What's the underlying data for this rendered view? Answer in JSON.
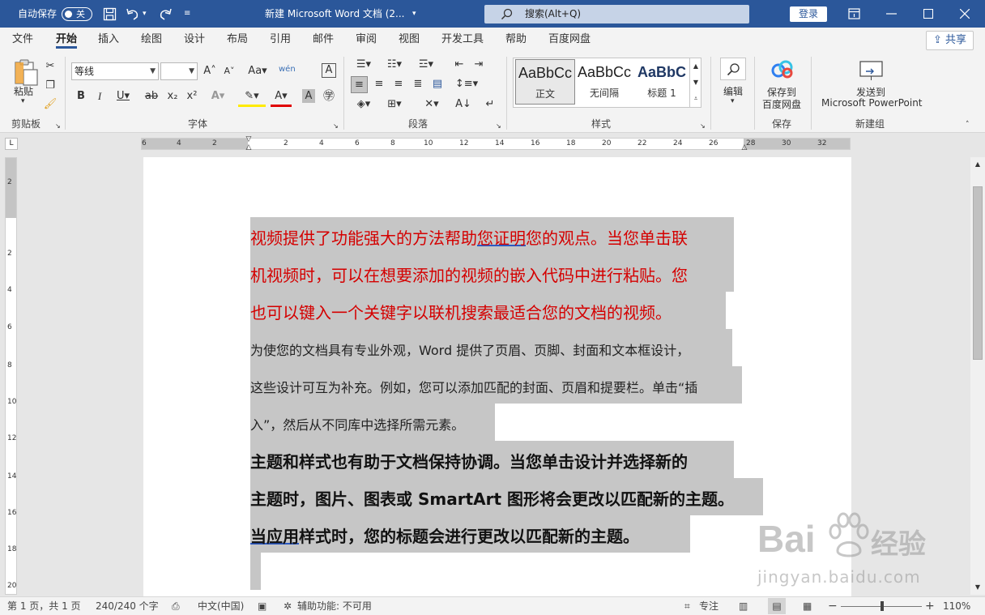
{
  "titlebar": {
    "autosave_label": "自动保存",
    "autosave_state": "关",
    "doc_title": "新建 Microsoft Word 文档 (2...",
    "search_placeholder": "搜索(Alt+Q)",
    "login": "登录"
  },
  "tabs": [
    "文件",
    "开始",
    "插入",
    "绘图",
    "设计",
    "布局",
    "引用",
    "邮件",
    "审阅",
    "视图",
    "开发工具",
    "帮助",
    "百度网盘"
  ],
  "active_tab": "开始",
  "share": "共享",
  "ribbon": {
    "clipboard": {
      "paste": "粘贴",
      "group": "剪贴板"
    },
    "font": {
      "font_name": "等线",
      "font_size": "",
      "group": "字体"
    },
    "paragraph": {
      "group": "段落"
    },
    "styles": {
      "items": [
        {
          "sample": "AaBbCc",
          "name": "正文"
        },
        {
          "sample": "AaBbCc",
          "name": "无间隔"
        },
        {
          "sample": "AaBbC",
          "name": "标题 1"
        }
      ],
      "group": "样式"
    },
    "editing": {
      "label": "编辑"
    },
    "save": {
      "btn_line1": "保存到",
      "btn_line2": "百度网盘",
      "group": "保存"
    },
    "newgroup": {
      "btn_line1": "发送到",
      "btn_line2": "Microsoft PowerPoint",
      "group": "新建组"
    }
  },
  "ruler": {
    "h_numbers": [
      "6",
      "4",
      "2",
      "2",
      "4",
      "6",
      "8",
      "10",
      "12",
      "14",
      "16",
      "18",
      "20",
      "22",
      "24",
      "26",
      "28",
      "30",
      "32"
    ],
    "v_numbers": [
      "2",
      "2",
      "4",
      "6",
      "8",
      "10",
      "12",
      "14",
      "16",
      "18",
      "20"
    ]
  },
  "document": {
    "para1": [
      "视频提供了功能强大的方法帮助",
      "您证明",
      "您的观点。当您单击联",
      "机视频时，可以在想要添加的视频的嵌入代码中进行粘贴。您",
      "也可以键入一个关键字以联机搜索最适合您的文档的视频。"
    ],
    "para2": [
      "为使您的文档具有专业外观，Word 提供了页眉、页脚、封面和文本框设计，",
      "这些设计可互为补充。例如，您可以添加匹配的封面、页眉和提要栏。单击“插",
      "入”，然后从不同库中选择所需元素。"
    ],
    "para3": [
      "主题和样式也有助于文档保持协调。当您单击设计并选择新的",
      "主题时，图片、图表或 SmartArt 图形将会更改以匹配新的主题。",
      "当应用",
      "样式时，您的标题会进行更改以匹配新的主题。"
    ]
  },
  "status": {
    "page": "第 1 页，共 1 页",
    "words": "240/240 个字",
    "lang": "中文(中国)",
    "accessibility": "辅助功能: 不可用",
    "focus": "专注",
    "zoom": "110%",
    "zoom_minus": "−",
    "zoom_plus": "+"
  },
  "watermark": {
    "brand": "Bai",
    "brand2": "经验",
    "url": "jingyan.baidu.com"
  },
  "colors": {
    "title_bar": "#2b579a",
    "red_text": "#d40000",
    "selection": "#c6c6c6"
  }
}
